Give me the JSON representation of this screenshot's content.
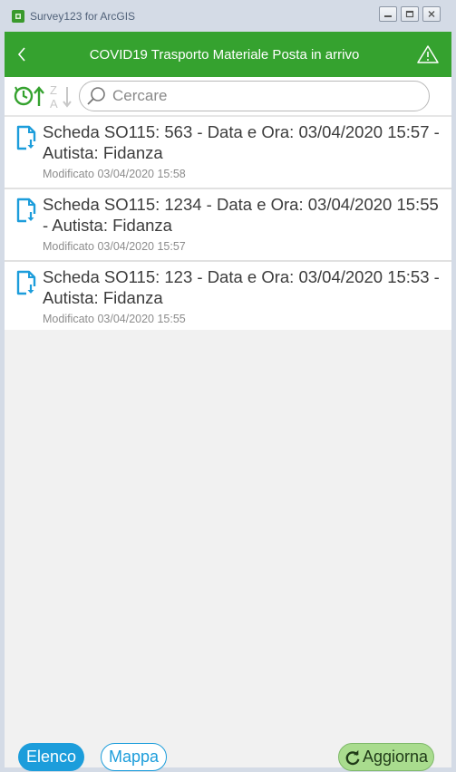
{
  "window": {
    "title": "Survey123 for ArcGIS"
  },
  "header": {
    "title": "COVID19 Trasporto Materiale Posta in arrivo",
    "bg_color": "#35a22f"
  },
  "toolbar": {
    "sort_time_icon": "clock-sort-icon",
    "sort_az_icon": "sort-za-icon",
    "search_placeholder": "Cercare"
  },
  "list": {
    "items": [
      {
        "title": "Scheda SO115: 563 - Data e Ora: 03/04/2020 15:57 - Autista: Fidanza",
        "modified": "Modificato 03/04/2020 15:58"
      },
      {
        "title": "Scheda SO115: 1234 - Data e Ora: 03/04/2020 15:55 - Autista: Fidanza",
        "modified": "Modificato 03/04/2020 15:57"
      },
      {
        "title": "Scheda SO115: 123 - Data e Ora: 03/04/2020 15:53 - Autista: Fidanza",
        "modified": "Modificato 03/04/2020 15:55"
      }
    ]
  },
  "bottom": {
    "elenco_label": "Elenco",
    "mappa_label": "Mappa",
    "aggiorna_label": "Aggiorna",
    "accent_color": "#1c9ddb"
  }
}
